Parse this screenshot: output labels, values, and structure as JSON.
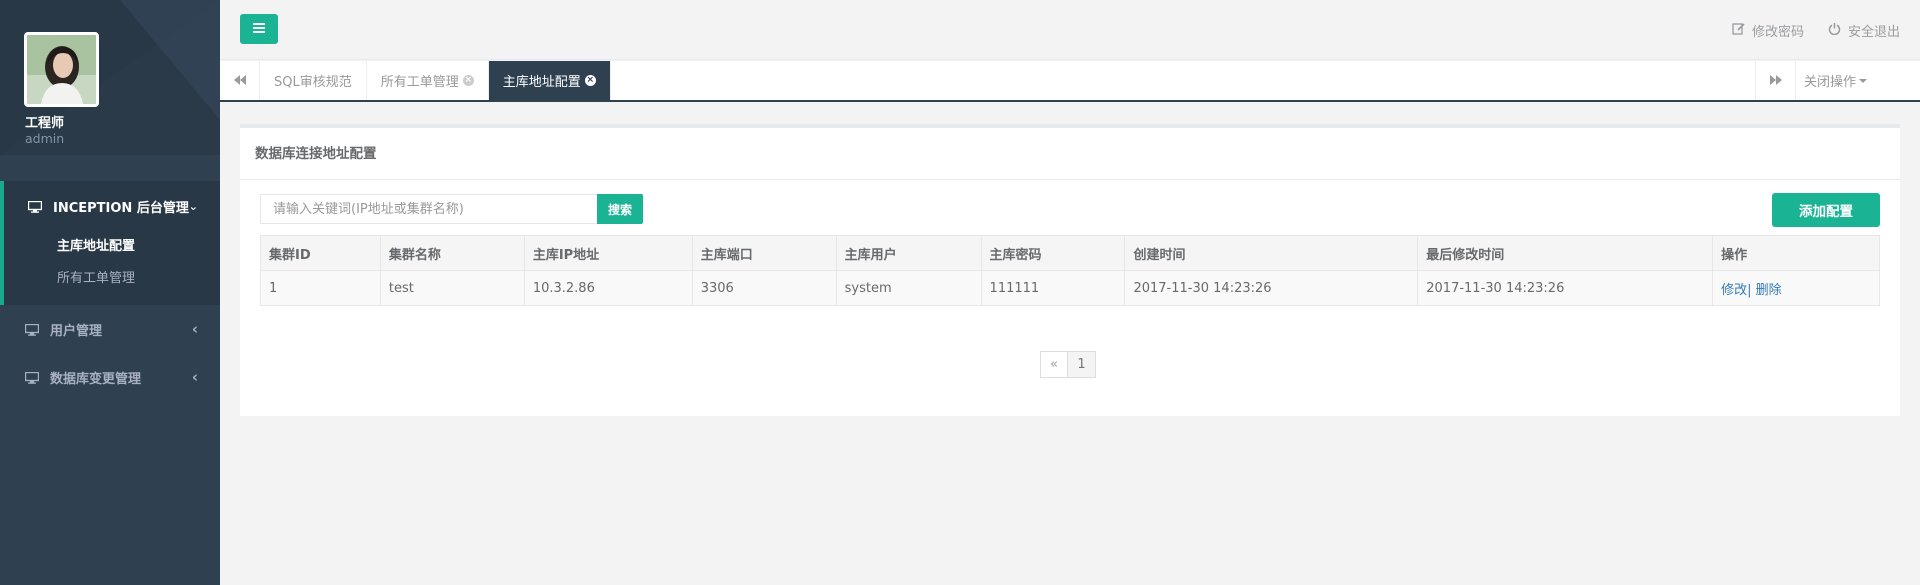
{
  "user": {
    "name": "工程师",
    "role": "admin"
  },
  "sidebar": {
    "groups": [
      {
        "label": "INCEPTION 后台管理",
        "chevron": "⌄",
        "items": [
          {
            "label": "主库地址配置"
          },
          {
            "label": "所有工单管理"
          }
        ]
      },
      {
        "label": "用户管理",
        "chevron": "‹"
      },
      {
        "label": "数据库变更管理",
        "chevron": "‹"
      }
    ]
  },
  "topbar": {
    "change_password": "修改密码",
    "logout": "安全退出"
  },
  "tabs": {
    "items": [
      {
        "label": "SQL审核规范"
      },
      {
        "label": "所有工单管理"
      },
      {
        "label": "主库地址配置"
      }
    ],
    "close_ops": "关闭操作"
  },
  "panel": {
    "title": "数据库连接地址配置",
    "search_placeholder": "请输入关键词(IP地址或集群名称)",
    "search_label": "搜索",
    "add_label": "添加配置"
  },
  "table": {
    "headers": [
      "集群ID",
      "集群名称",
      "主库IP地址",
      "主库端口",
      "主库用户",
      "主库密码",
      "创建时间",
      "最后修改时间",
      "操作"
    ],
    "rows": [
      {
        "cells": [
          "1",
          "test",
          "10.3.2.86",
          "3306",
          "system",
          "111111",
          "2017-11-30 14:23:26",
          "2017-11-30 14:23:26"
        ],
        "edit": "修改",
        "sep": "|",
        "delete": "删除"
      }
    ]
  },
  "pagination": {
    "prev": "«",
    "pages": [
      "1"
    ]
  },
  "colors": {
    "accent": "#1ab394",
    "sidebar": "#2f4050",
    "link": "#337ab7"
  },
  "icons": {
    "menu": "menu-icon",
    "edit": "edit-icon",
    "power": "power-icon",
    "monitor": "monitor-icon"
  }
}
